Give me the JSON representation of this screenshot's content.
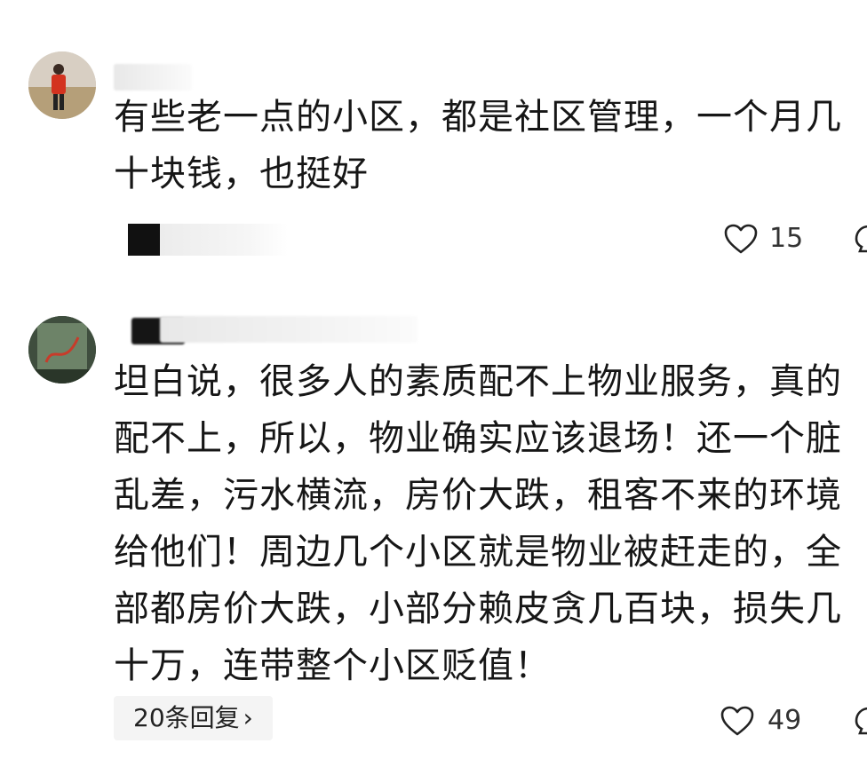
{
  "comments": [
    {
      "text": "有些老一点的小区，都是社区管理，一个月几十块钱，也挺好",
      "likes": "15",
      "like_icon": "heart-outline-icon"
    },
    {
      "text": "坦白说，很多人的素质配不上物业服务，真的配不上，所以，物业确实应该退场！还一个脏乱差，污水横流，房价大跌，租客不来的环境给他们！周边几个小区就是物业被赶走的，全部都房价大跌，小部分赖皮贪几百块，损失几十万，连带整个小区贬值！",
      "likes": "49",
      "like_icon": "heart-outline-icon",
      "replies_label": "20条回复",
      "replies_icon": "chevron-right-icon"
    }
  ]
}
